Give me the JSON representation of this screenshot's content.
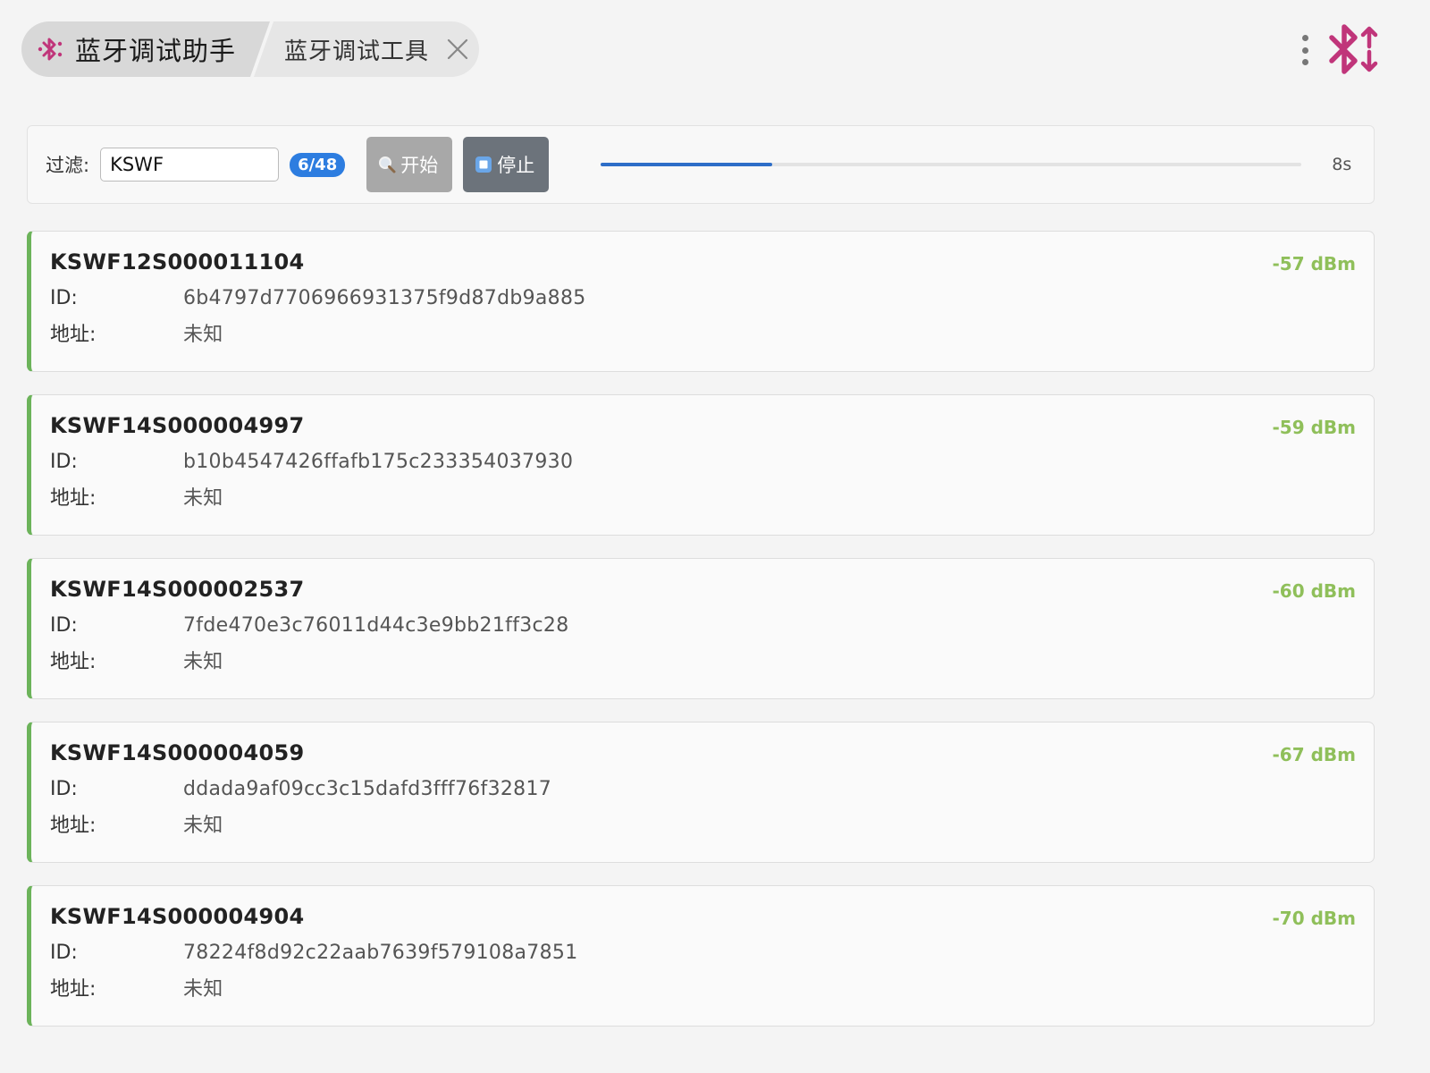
{
  "tabs": [
    {
      "label": "蓝牙调试助手",
      "active": true,
      "icon": "bluetooth-icon"
    },
    {
      "label": "蓝牙调试工具",
      "active": false,
      "closable": true
    }
  ],
  "colors": {
    "accent": "#c0357a",
    "badge": "#2d7de0",
    "rssi": "#8fbf5a",
    "card_border": "#6cb35a",
    "progress": "#2e6ec8"
  },
  "filter": {
    "label": "过滤:",
    "value": "KSWF",
    "count": "6/48",
    "start_label": "开始",
    "stop_label": "停止",
    "progress": 0.245,
    "timer": "8s"
  },
  "device_labels": {
    "id": "ID:",
    "address": "地址:"
  },
  "devices": [
    {
      "name": "KSWF12S000011104",
      "rssi": "-57 dBm",
      "id": "6b4797d7706966931375f9d87db9a885",
      "address": "未知"
    },
    {
      "name": "KSWF14S000004997",
      "rssi": "-59 dBm",
      "id": "b10b4547426ffafb175c233354037930",
      "address": "未知"
    },
    {
      "name": "KSWF14S000002537",
      "rssi": "-60 dBm",
      "id": "7fde470e3c76011d44c3e9bb21ff3c28",
      "address": "未知"
    },
    {
      "name": "KSWF14S000004059",
      "rssi": "-67 dBm",
      "id": "ddada9af09cc3c15dafd3fff76f32817",
      "address": "未知"
    },
    {
      "name": "KSWF14S000004904",
      "rssi": "-70 dBm",
      "id": "78224f8d92c22aab7639f579108a7851",
      "address": "未知"
    }
  ]
}
